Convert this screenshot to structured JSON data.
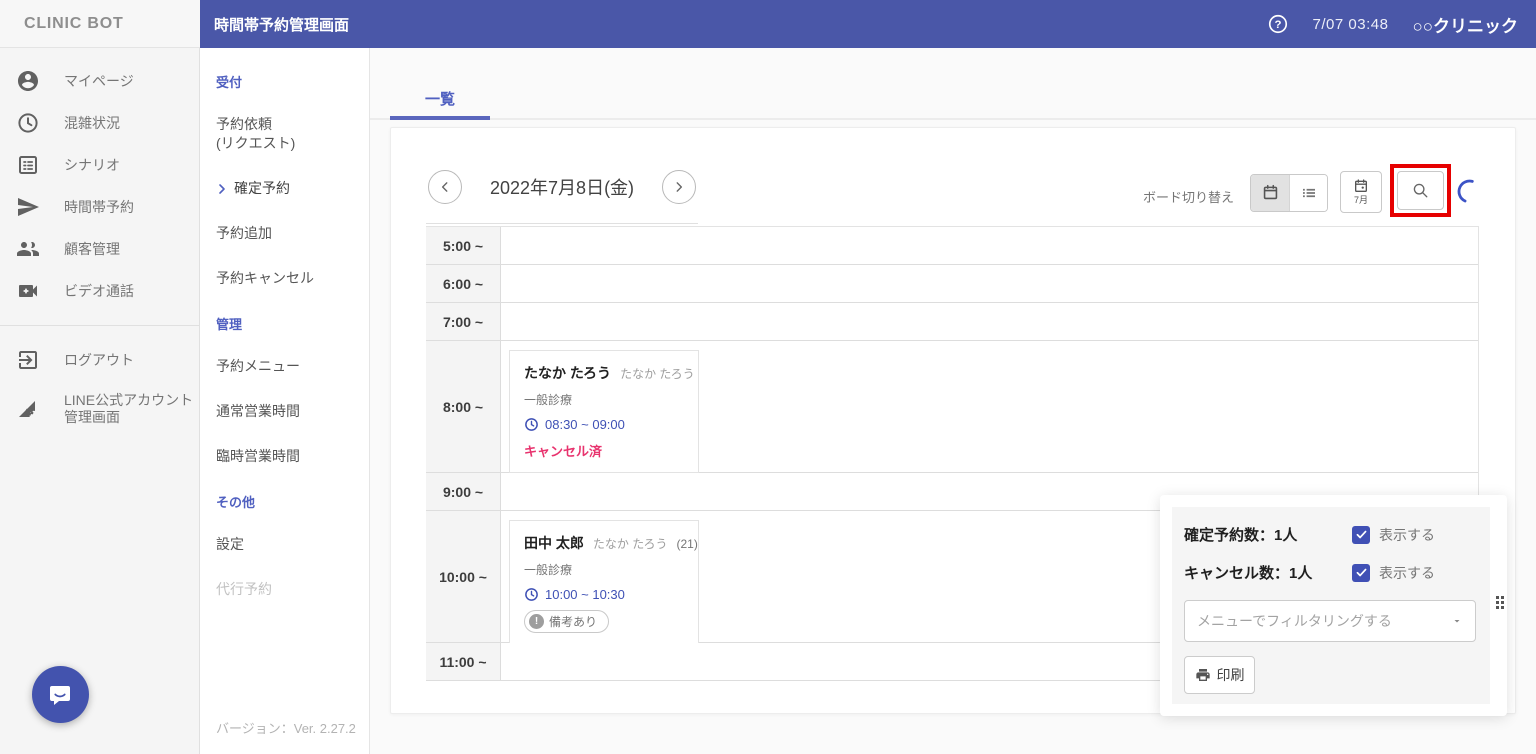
{
  "colors": {
    "brand": "#4a57a8",
    "accent": "#5060c0",
    "time_blue": "#3f51b5",
    "cancel_pink": "#e8336e",
    "highlight_red": "#e60000",
    "checkbox_blue": "#4050b5"
  },
  "header": {
    "logo": "CLINIC BOT",
    "title": "時間帯予約管理画面",
    "datetime": "7/07 03:48",
    "clinic": "○○クリニック"
  },
  "nav": {
    "items": [
      {
        "icon": "account-circle-icon",
        "label": "マイページ"
      },
      {
        "icon": "clock-icon",
        "label": "混雑状況"
      },
      {
        "icon": "list-alt-icon",
        "label": "シナリオ"
      },
      {
        "icon": "send-icon",
        "label": "時間帯予約"
      },
      {
        "icon": "people-icon",
        "label": "顧客管理"
      },
      {
        "icon": "video-call-icon",
        "label": "ビデオ通話"
      }
    ],
    "logout": "ログアウト",
    "line_admin_line1": "LINE公式アカウント",
    "line_admin_line2": "管理画面"
  },
  "subnav": {
    "reception_heading": "受付",
    "request_line1": "予約依頼",
    "request_line2": "(リクエスト)",
    "confirmed": "確定予約",
    "add": "予約追加",
    "cancel": "予約キャンセル",
    "manage_heading": "管理",
    "menu": "予約メニュー",
    "regular_hours": "通常営業時間",
    "special_hours": "臨時営業時間",
    "other_heading": "その他",
    "settings": "設定",
    "proxy_booking": "代行予約",
    "version": "バージョン：Ver. 2.27.2"
  },
  "main": {
    "tab": "一覧",
    "date_label": "2022年7月8日(金)",
    "board_toggle_label": "ボード切り替え",
    "month_button_label": "7月",
    "time_rows": [
      "5:00 ~",
      "6:00 ~",
      "7:00 ~",
      "8:00 ~",
      "9:00 ~",
      "10:00 ~",
      "11:00 ~"
    ],
    "appointments": [
      {
        "name": "たなか たろう",
        "kana": "たなか たろう",
        "menu": "一般診療",
        "time": "08:30 ~ 09:00",
        "status": "キャンセル済"
      },
      {
        "name": "田中 太郎",
        "kana": "たなか たろう",
        "age": "(21)",
        "menu": "一般診療",
        "time": "10:00 ~ 10:30",
        "note_badge": "備考あり"
      }
    ]
  },
  "summary_panel": {
    "confirmed_label": "確定予約数：1人",
    "cancelled_label": "キャンセル数：1人",
    "show_label": "表示する",
    "filter_placeholder": "メニューでフィルタリングする",
    "print_label": "印刷"
  },
  "icons": [
    "account-circle-icon",
    "clock-icon",
    "list-alt-icon",
    "send-icon",
    "people-icon",
    "video-call-icon",
    "logout-icon",
    "line-admin-icon",
    "help-icon",
    "chevron-left-icon",
    "chevron-right-icon",
    "calendar-icon",
    "list-view-icon",
    "calendar-month-icon",
    "search-icon",
    "loading-spinner",
    "clock-small-icon",
    "info-icon",
    "check-icon",
    "dropdown-caret-icon",
    "print-icon",
    "drag-handle-icon",
    "chat-bubble-icon"
  ]
}
